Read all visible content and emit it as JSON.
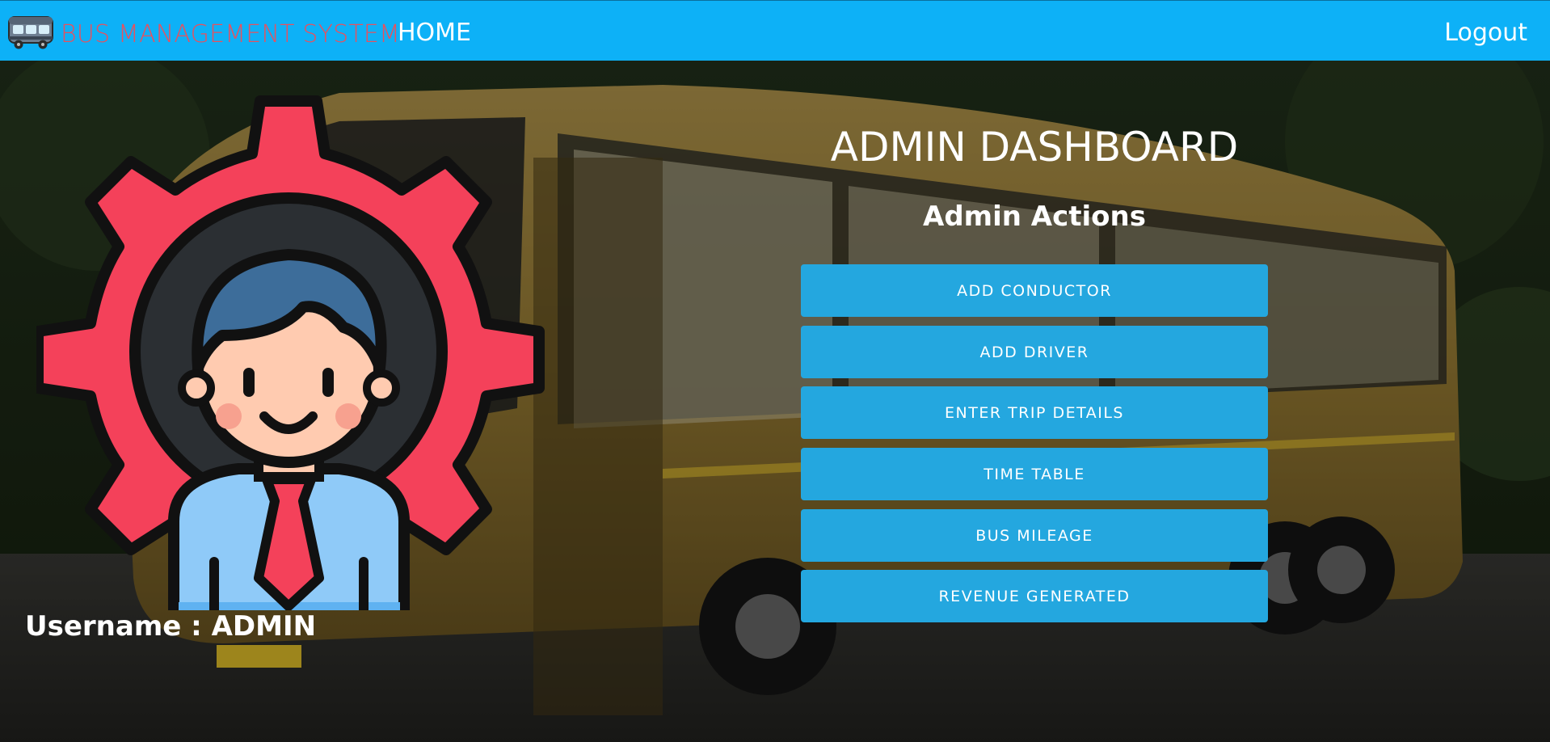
{
  "nav": {
    "brand_icon": "bus-icon",
    "brand_text": "BUS MANAGEMENT SYSTEM",
    "home_label": "HOME",
    "logout_label": "Logout",
    "bar_color": "#0db1f7",
    "brand_color": "#e8515e"
  },
  "hero": {
    "background": "bus-photo",
    "avatar_icon": "admin-gear-avatar-icon"
  },
  "main": {
    "title": "ADMIN DASHBOARD",
    "subtitle": "Admin Actions",
    "actions": [
      {
        "label": "ADD CONDUCTOR"
      },
      {
        "label": "ADD DRIVER"
      },
      {
        "label": "ENTER TRIP DETAILS"
      },
      {
        "label": "TIME TABLE"
      },
      {
        "label": "BUS MILEAGE"
      },
      {
        "label": "REVENUE GENERATED"
      }
    ],
    "button_color": "#24a7df"
  },
  "user": {
    "username_label": "Username : ADMIN"
  }
}
